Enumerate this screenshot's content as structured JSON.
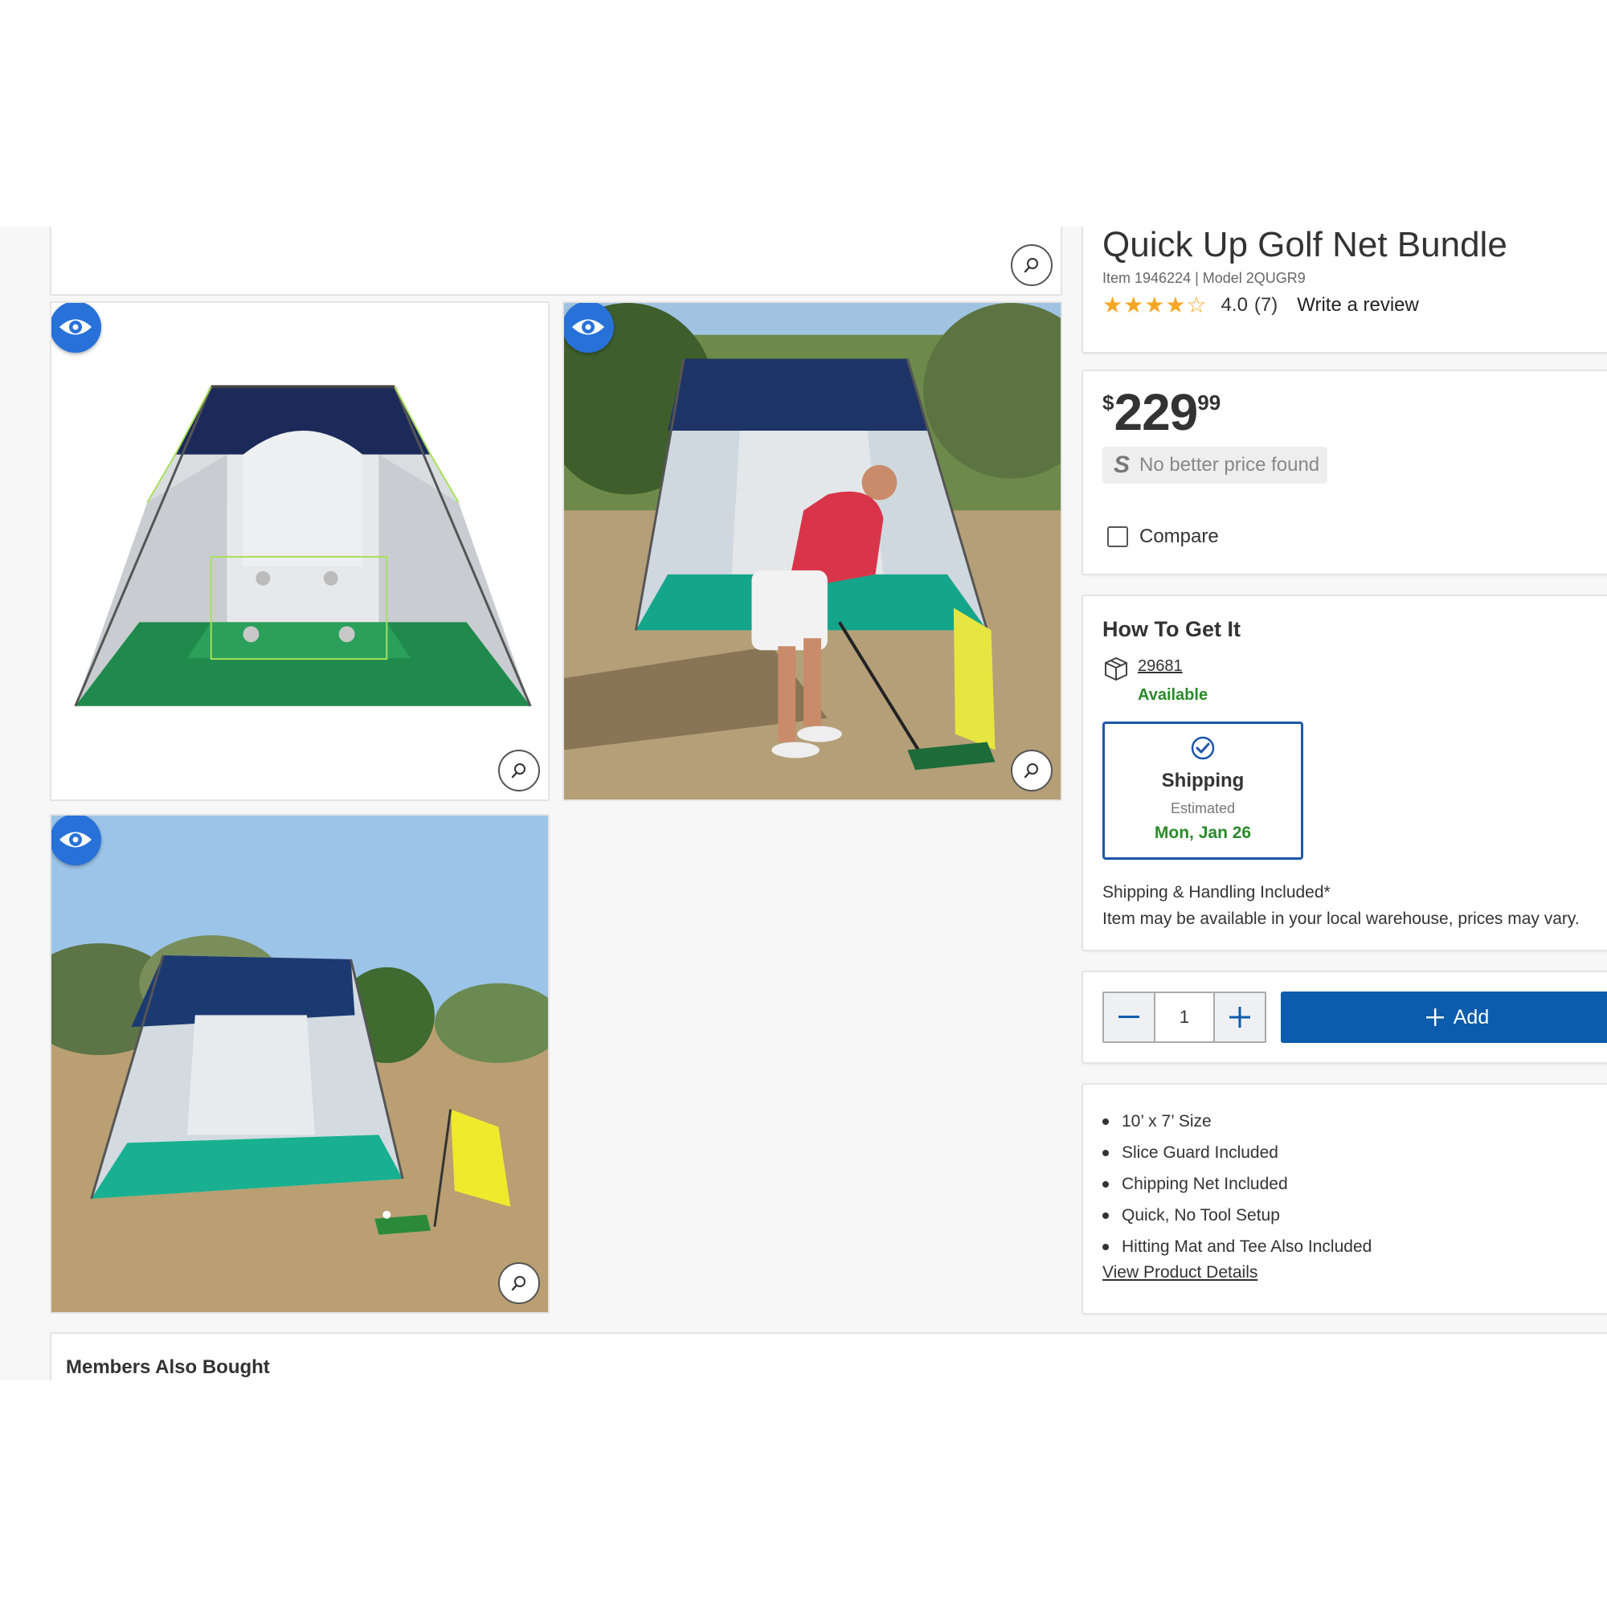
{
  "product": {
    "title": "Quick Up Golf Net Bundle",
    "item_model": "Item 1946224 | Model 2QUGR9",
    "rating_value": "4.0",
    "rating_count": "(7)",
    "rating_stars": 4,
    "write_review": "Write a review"
  },
  "price": {
    "currency": "$",
    "dollars": "229",
    "cents": "99",
    "no_better_price": "No better price found",
    "compare_label": "Compare"
  },
  "fulfillment": {
    "heading": "How To Get It",
    "warehouse_zip": "29681",
    "availability": "Available",
    "shipping_label": "Shipping",
    "estimated_label": "Estimated",
    "estimated_date": "Mon, Jan 26",
    "note_line1": "Shipping & Handling Included*",
    "note_line2": "Item may be available in your local warehouse, prices may vary."
  },
  "cart": {
    "quantity": "1",
    "add_label": "Add"
  },
  "features": {
    "items": [
      "10’ x 7’ Size",
      "Slice Guard Included",
      "Chipping Net Included",
      "Quick, No Tool Setup",
      "Hitting Mat and Tee Also Included"
    ],
    "view_details": "View Product Details"
  },
  "members_also_bought": "Members Also Bought",
  "icons": {
    "view": "eye-icon",
    "zoom": "magnifier-icon",
    "warehouse": "box-icon",
    "shipping_check": "check-circle-icon",
    "minus": "minus-icon",
    "plus": "plus-icon"
  },
  "colors": {
    "accent_blue": "#0b5cad",
    "eye_badge": "#2771d9",
    "available_green": "#2a8a2a",
    "star": "#f5a623"
  }
}
